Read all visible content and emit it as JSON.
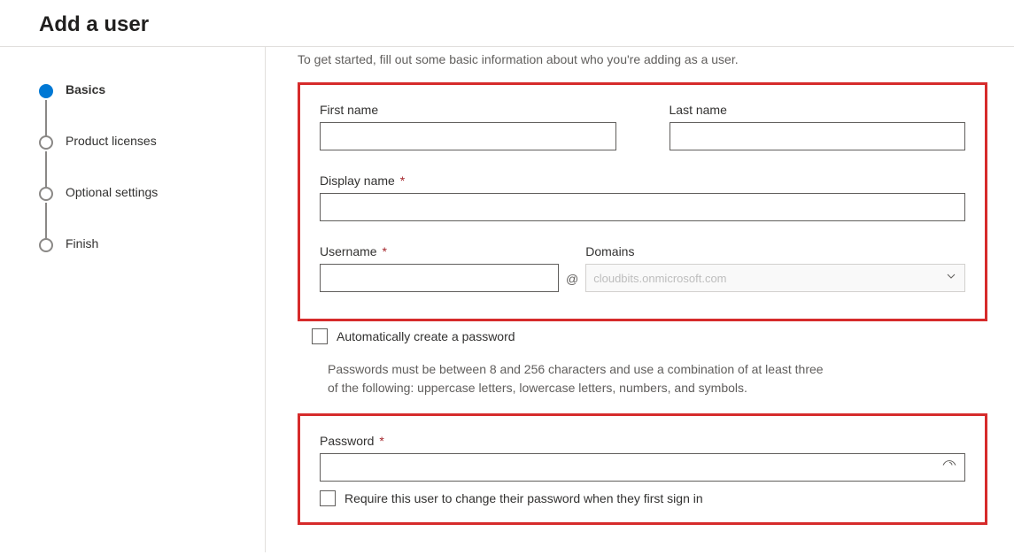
{
  "header": {
    "title": "Add a user"
  },
  "wizard": {
    "steps": [
      {
        "label": "Basics",
        "active": true
      },
      {
        "label": "Product licenses",
        "active": false
      },
      {
        "label": "Optional settings",
        "active": false
      },
      {
        "label": "Finish",
        "active": false
      }
    ]
  },
  "intro": "To get started, fill out some basic information about who you're adding as a user.",
  "form": {
    "first_name_label": "First name",
    "first_name_value": "",
    "last_name_label": "Last name",
    "last_name_value": "",
    "display_name_label": "Display name",
    "display_name_value": "",
    "username_label": "Username",
    "username_value": "",
    "at_symbol": "@",
    "domains_label": "Domains",
    "domain_value": "cloudbits.onmicrosoft.com",
    "auto_password_label": "Automatically create a password",
    "password_hint": "Passwords must be between 8 and 256 characters and use a combination of at least three of the following: uppercase letters, lowercase letters, numbers, and symbols.",
    "password_label": "Password",
    "password_value": "",
    "require_change_label": "Require this user to change their password when they first sign in"
  },
  "required_marker": "*"
}
